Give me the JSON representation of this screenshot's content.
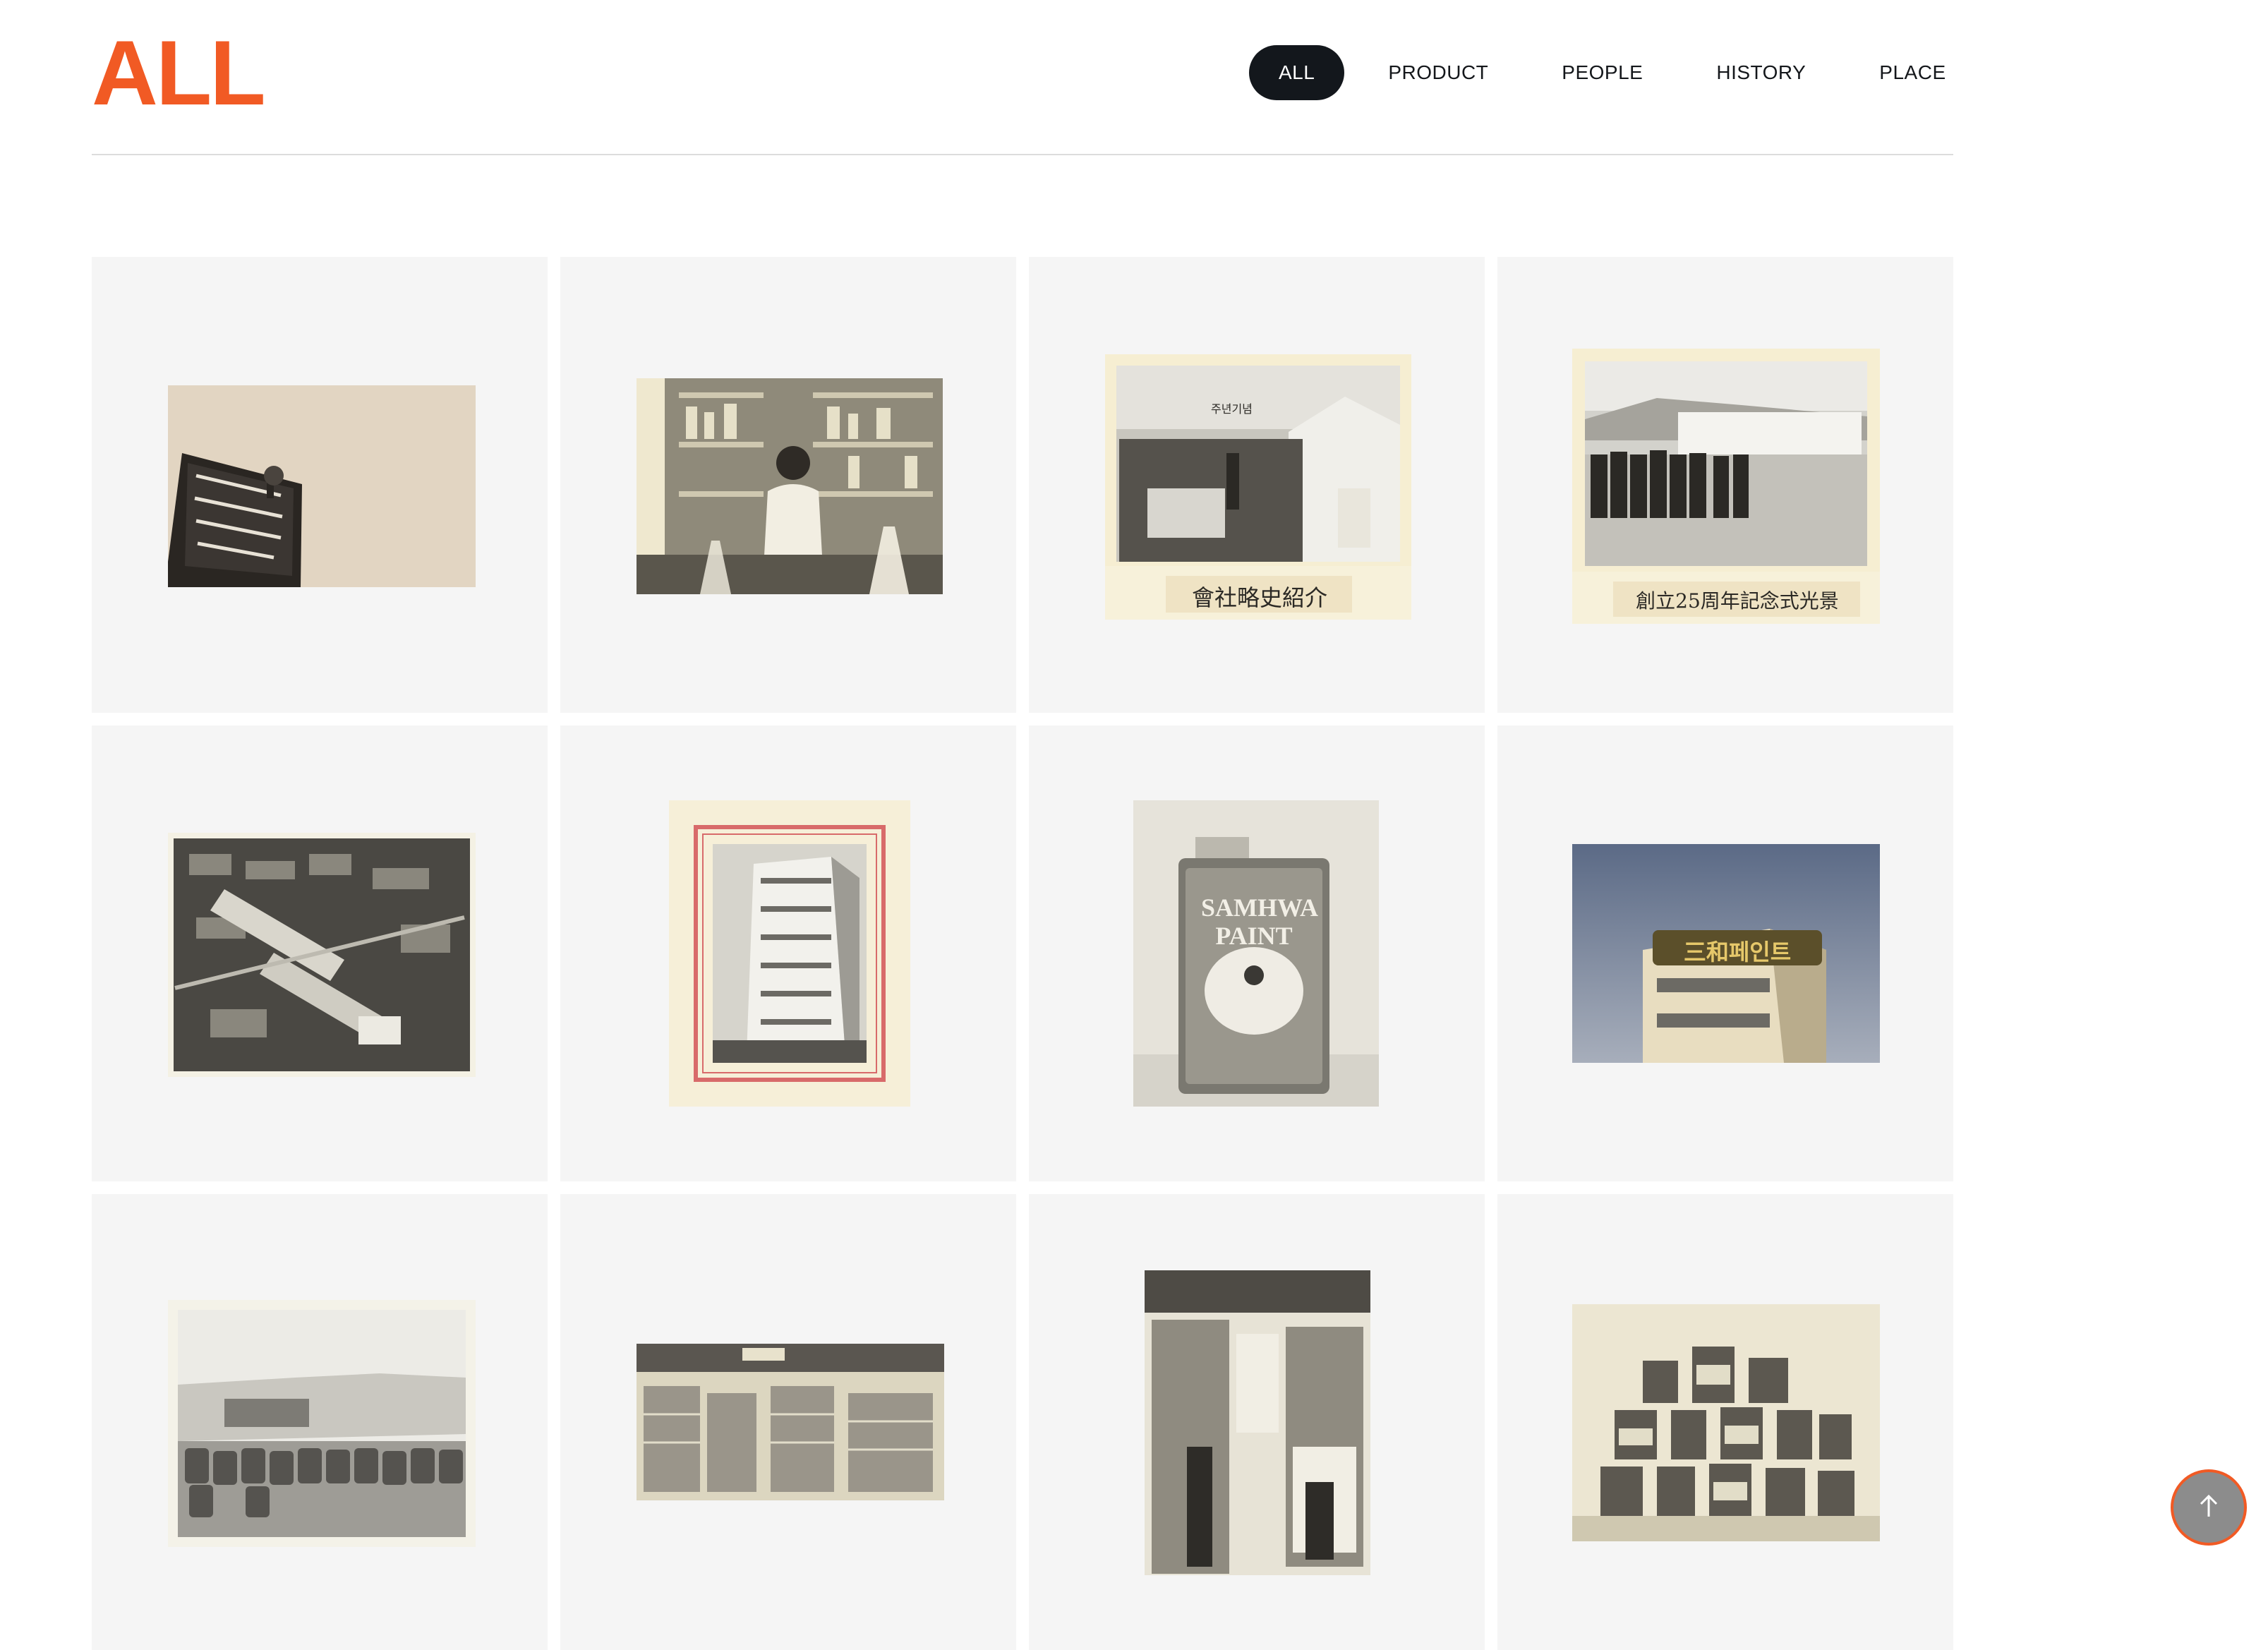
{
  "header": {
    "title": "ALL"
  },
  "filters": [
    {
      "label": "ALL"
    },
    {
      "label": "PRODUCT"
    },
    {
      "label": "PEOPLE"
    },
    {
      "label": "HISTORY"
    },
    {
      "label": "PLACE"
    }
  ],
  "theme": {
    "accent": "#F15A24",
    "active_tab_bg": "#13171C",
    "card_bg": "#F5F5F5"
  },
  "gallery": {
    "items": [
      {
        "icon": "signboard-photo"
      },
      {
        "icon": "laboratory-photo"
      },
      {
        "icon": "exhibition-booth-photo",
        "booth_sign": "주년기념",
        "caption": "會社略史紹介"
      },
      {
        "icon": "anniversary-ceremony-photo",
        "caption": "創立25周年記念式光景"
      },
      {
        "icon": "aerial-factory-photo"
      },
      {
        "icon": "office-building-photo"
      },
      {
        "icon": "paint-can-photo",
        "can_label": "SAMHWA PAINT"
      },
      {
        "icon": "building-sign-photo",
        "building_sign": "三和페인트"
      },
      {
        "icon": "barrel-yard-photo"
      },
      {
        "icon": "warehouse-photo"
      },
      {
        "icon": "stockroom-photo"
      },
      {
        "icon": "product-lineup-photo"
      }
    ]
  },
  "scroll_top": {
    "icon": "arrow-up-icon"
  }
}
